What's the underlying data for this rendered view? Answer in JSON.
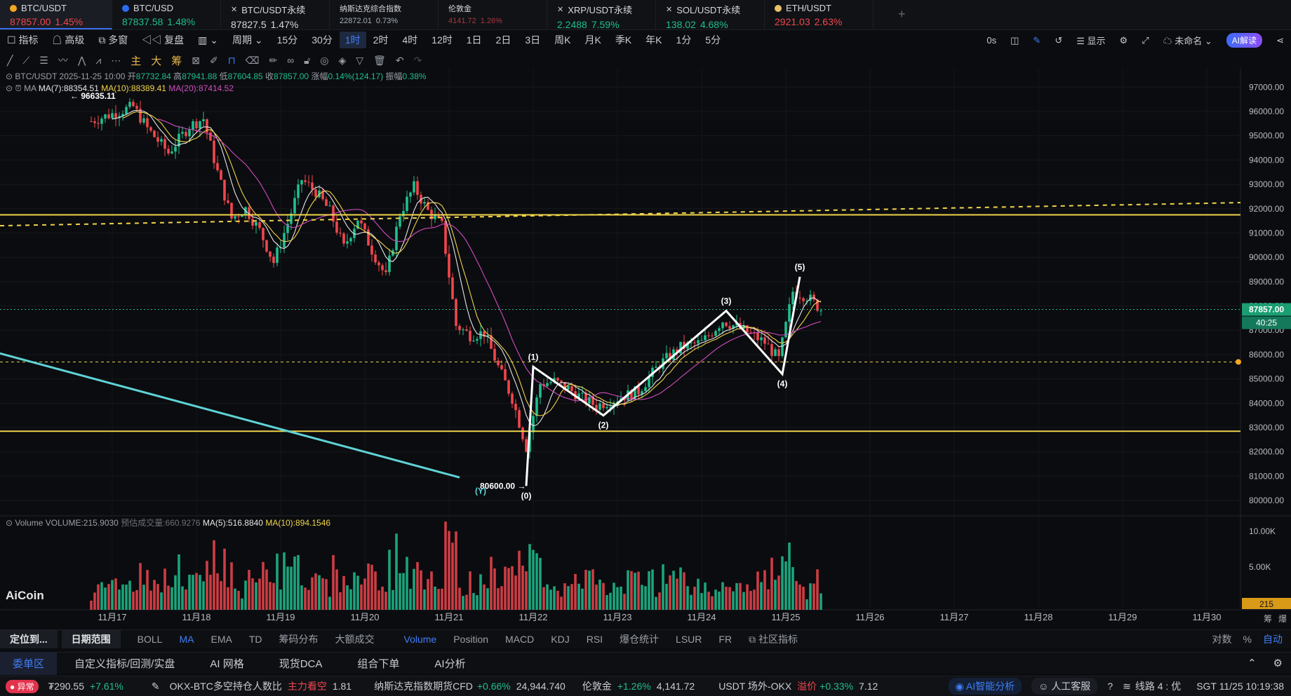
{
  "tickers": [
    {
      "symbol": "BTC/USDT",
      "price": "87857.00",
      "change": "1.45%",
      "dir": "dn",
      "icon": "bitcoin-icon",
      "active": true
    },
    {
      "symbol": "BTC/USD",
      "price": "87837.58",
      "change": "1.48%",
      "dir": "up",
      "icon": "coin-icon"
    },
    {
      "symbol": "BTC/USDT永续",
      "price": "87827.5",
      "change": "1.47%",
      "dir": "flat",
      "icon": "close-icon"
    },
    {
      "symbol": "纳斯达克综合指数",
      "price": "22872.01",
      "change": "0.73%",
      "dir": "flat",
      "icon": ""
    },
    {
      "symbol": "伦敦金",
      "price": "4141.72",
      "change": "1.26%",
      "dir": "dn",
      "icon": ""
    },
    {
      "symbol": "XRP/USDT永续",
      "price": "2.2488",
      "change": "7.59%",
      "dir": "up",
      "icon": "close-icon"
    },
    {
      "symbol": "SOL/USDT永续",
      "price": "138.02",
      "change": "4.68%",
      "dir": "up",
      "icon": "close-icon"
    },
    {
      "symbol": "ETH/USDT",
      "price": "2921.03",
      "change": "2.63%",
      "dir": "dn",
      "icon": "ethereum-icon"
    }
  ],
  "toolbar": {
    "indicator": "指标",
    "advanced": "高级",
    "multi_window": "多窗",
    "review": "复盘",
    "period": "周期",
    "intervals": [
      "15分",
      "30分",
      "1时",
      "2时",
      "4时",
      "12时",
      "1日",
      "2日",
      "3日",
      "周K",
      "月K",
      "季K",
      "年K",
      "1分",
      "5分"
    ],
    "selected_interval": "1时",
    "right_items": [
      "0s",
      "显示",
      "未命名"
    ],
    "ai_read": "AI解读"
  },
  "draw_tools_hz": [
    "主",
    "大",
    "筹"
  ],
  "chart_header": {
    "symbol": "BTC/USDT",
    "datetime": "2025-11-25 10:00",
    "open_label": "开",
    "open": "87732.84",
    "high_label": "高",
    "high": "87941.88",
    "low_label": "低",
    "low": "87604.85",
    "close_label": "收",
    "close": "87857.00",
    "chg_label": "涨幅",
    "chg": "0.14%(124.17)",
    "amp_label": "振幅",
    "amp": "0.38%",
    "ma_label": "MA",
    "ma7": "MA(7):88354.51",
    "ma10": "MA(10):88389.41",
    "ma20": "MA(20):87414.52"
  },
  "chart_data": {
    "type": "candlestick",
    "y_ticks": [
      "97000.00",
      "96000.00",
      "95000.00",
      "94000.00",
      "93000.00",
      "92000.00",
      "91000.00",
      "90000.00",
      "89000.00",
      "88000.00",
      "87000.00",
      "86000.00",
      "85000.00",
      "84000.00",
      "83000.00",
      "82000.00",
      "81000.00",
      "80000.00"
    ],
    "ylim": [
      79600,
      97700
    ],
    "x_ticks": [
      "11月17",
      "11月18",
      "11月19",
      "11月20",
      "11月21",
      "11月22",
      "11月23",
      "11月24",
      "11月25",
      "11月26",
      "11月27",
      "11月28",
      "11月29",
      "11月30"
    ],
    "last_price": "87857.00",
    "countdown": "40:25",
    "high_marker": "96635.11",
    "low_marker": "80600.00",
    "horizontal_levels": [
      91750,
      82850
    ],
    "dashed_levels": [
      85700
    ],
    "wave_labels": [
      {
        "label": "(0)",
        "x": "11月21 22:00",
        "y": 80600
      },
      {
        "label": "(1)",
        "x": "11月22 00:00",
        "y": 85500
      },
      {
        "label": "(2)",
        "x": "11月22 20:00",
        "y": 83500
      },
      {
        "label": "(3)",
        "x": "11月24 07:00",
        "y": 87800
      },
      {
        "label": "(4)",
        "x": "11月24 23:00",
        "y": 85200
      },
      {
        "label": "(5)",
        "x": "11月25 04:00",
        "y": 89200
      },
      {
        "label": "(Y)",
        "x": "11月21 09:00",
        "y": 80800
      }
    ],
    "price_path": [
      [
        "11月16 18:00",
        95600
      ],
      [
        "11月17 00:00",
        95900
      ],
      [
        "11月17 06:00",
        96200
      ],
      [
        "11月17 10:00",
        95300
      ],
      [
        "11月17 16:00",
        94300
      ],
      [
        "11月17 22:00",
        95400
      ],
      [
        "11月18 02:00",
        95700
      ],
      [
        "11月18 06:00",
        93500
      ],
      [
        "11月18 10:00",
        91600
      ],
      [
        "11月18 14:00",
        92000
      ],
      [
        "11月18 18:00",
        91100
      ],
      [
        "11;18 22:00",
        89800
      ],
      [
        "11月19 02:00",
        91400
      ],
      [
        "11月19 06:00",
        93200
      ],
      [
        "11月19 10:00",
        92700
      ],
      [
        "11月19 14:00",
        91900
      ],
      [
        "11月19 18:00",
        90400
      ],
      [
        "11月19 22:00",
        91600
      ],
      [
        "11月20 02:00",
        90300
      ],
      [
        "11月20 06:00",
        89200
      ],
      [
        "11月20 10:00",
        91800
      ],
      [
        "11月20 14:00",
        92900
      ],
      [
        "11月20 18:00",
        91900
      ],
      [
        "11月20 22:00",
        91300
      ],
      [
        "11月21 02:00",
        87200
      ],
      [
        "11月21 06:00",
        86800
      ],
      [
        "11月21 10:00",
        86900
      ],
      [
        "11月21 14:00",
        85500
      ],
      [
        "11月21 18:00",
        84200
      ],
      [
        "11月21 22:00",
        82200
      ],
      [
        "11月22 02:00",
        84800
      ],
      [
        "11月22 06:00",
        84900
      ],
      [
        "11月22 10:00",
        84600
      ],
      [
        "11月22 14:00",
        84200
      ],
      [
        "11月22 18:00",
        83900
      ],
      [
        "11月23 00:00",
        84200
      ],
      [
        "11月23 06:00",
        84500
      ],
      [
        "11月23 12:00",
        85600
      ],
      [
        "11月23 18:00",
        86300
      ],
      [
        "11月24 00:00",
        86500
      ],
      [
        "11月24 06:00",
        87400
      ],
      [
        "11月24 12:00",
        87000
      ],
      [
        "11月24 18:00",
        86500
      ],
      [
        "11月24 22:00",
        85800
      ],
      [
        "11月25 02:00",
        88600
      ],
      [
        "11月25 06:00",
        88400
      ],
      [
        "11月25 10:00",
        87857
      ]
    ],
    "volume": {
      "label": "Volume",
      "value": "VOLUME:215.9030",
      "est": "预估成交量:660.9276",
      "ma5": "MA(5):516.8840",
      "ma10": "MA(10):894.1546",
      "y_ticks": [
        "10.00K",
        "5.00K"
      ],
      "last": "215"
    }
  },
  "branding": "AiCoin",
  "right_axis_footer": {
    "pin": "筹",
    "burst": "爆"
  },
  "indicator_bar": {
    "locate": "定位到...",
    "date_range": "日期范围",
    "main": [
      "BOLL",
      "MA",
      "EMA",
      "TD",
      "筹码分布",
      "大额成交"
    ],
    "main_active": "MA",
    "sub": [
      "Volume",
      "Position",
      "MACD",
      "KDJ",
      "RSI",
      "爆仓统计",
      "LSUR",
      "FR",
      "社区指标"
    ],
    "sub_active": "Volume",
    "right": [
      "对数",
      "%",
      "自动"
    ]
  },
  "panel_tabs": [
    "委单区",
    "自定义指标/回测/实盘",
    "AI 网格",
    "现货DCA",
    "组合下单",
    "AI分析"
  ],
  "status_bar": {
    "abn": "异常",
    "price": "₮290.55",
    "price_chg": "+7.61%",
    "okx_ratio_label": "OKX-BTC多空持仓人数比",
    "okx_ratio_tag": "主力看空",
    "okx_ratio": "1.81",
    "nasdaq_label": "纳斯达克指数期货CFD",
    "nasdaq_chg": "+0.66%",
    "nasdaq": "24,944.740",
    "gold_label": "伦敦金",
    "gold_chg": "+1.26%",
    "gold": "4,141.72",
    "usdt_label": "USDT 场外-OKX",
    "premium_label": "溢价",
    "premium_chg": "+0.33%",
    "premium": "7.12",
    "ai_analysis": "AI智能分析",
    "human_service": "人工客服",
    "line": "线路 4 : 优",
    "time": "SGT 11/25 10:19:38"
  },
  "colors": {
    "up": "#1fbf8f",
    "down": "#f0474d",
    "level": "#f0d34b",
    "trend": "#5fd3d6",
    "ma7": "#e6e6e6",
    "ma10": "#f0d34b",
    "ma20": "#d04cc0",
    "accent": "#3f7ef7"
  }
}
